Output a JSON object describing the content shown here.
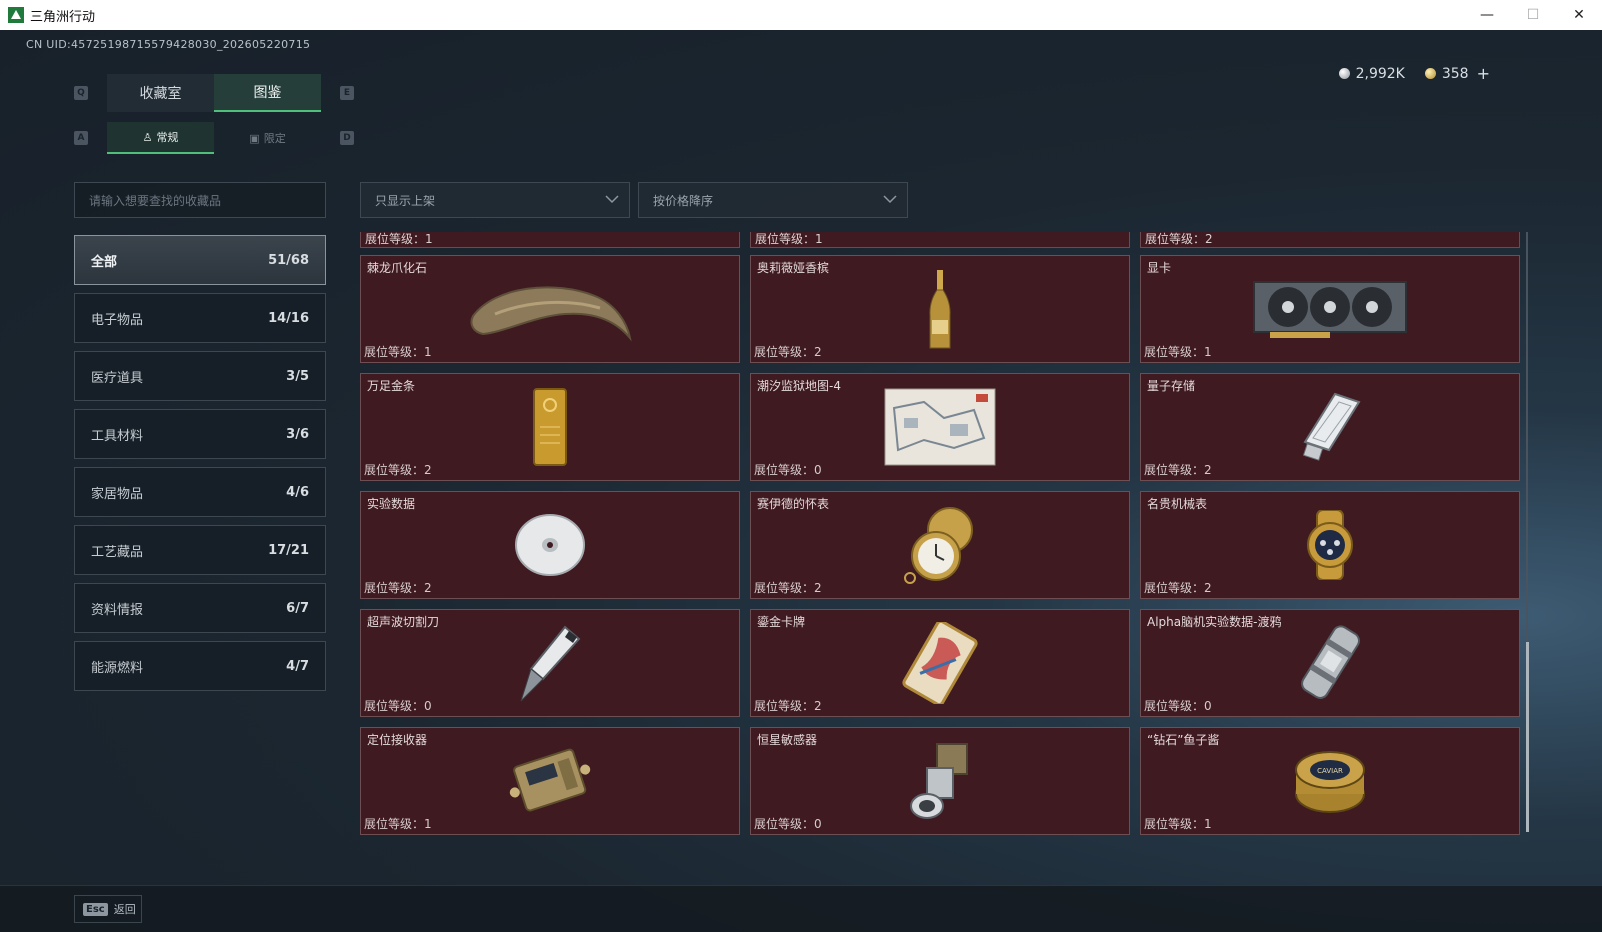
{
  "window": {
    "title": "三角洲行动",
    "minimize_glyph": "—",
    "maximize_glyph": "☐",
    "close_glyph": "✕"
  },
  "uid": "CN UID:45725198715579428030_202605220715",
  "currency": {
    "silver": "2,992K",
    "gold": "358",
    "add_glyph": "+"
  },
  "key_hints": {
    "q": "Q",
    "e": "E",
    "a": "A",
    "d": "D"
  },
  "main_tabs": [
    {
      "label": "收藏室"
    },
    {
      "label": "图鉴"
    }
  ],
  "sub_tabs": [
    {
      "label": "常规"
    },
    {
      "label": "限定"
    }
  ],
  "search": {
    "placeholder": "请输入想要查找的收藏品"
  },
  "filters": {
    "shelf_filter": "只显示上架",
    "sort": "按价格降序"
  },
  "categories": [
    {
      "label": "全部",
      "count": "51/68"
    },
    {
      "label": "电子物品",
      "count": "14/16"
    },
    {
      "label": "医疗道具",
      "count": "3/5"
    },
    {
      "label": "工具材料",
      "count": "3/6"
    },
    {
      "label": "家居物品",
      "count": "4/6"
    },
    {
      "label": "工艺藏品",
      "count": "17/21"
    },
    {
      "label": "资料情报",
      "count": "6/7"
    },
    {
      "label": "能源燃料",
      "count": "4/7"
    }
  ],
  "partial_row": [
    {
      "level": "展位等级：1"
    },
    {
      "level": "展位等级：1"
    },
    {
      "level": "展位等级：2"
    }
  ],
  "items": [
    {
      "name": "棘龙爪化石",
      "level": "展位等级：1",
      "icon": "claw-fossil-icon"
    },
    {
      "name": "奥莉薇娅香槟",
      "level": "展位等级：2",
      "icon": "champagne-bottle-icon"
    },
    {
      "name": "显卡",
      "level": "展位等级：1",
      "icon": "graphics-card-icon"
    },
    {
      "name": "万足金条",
      "level": "展位等级：2",
      "icon": "gold-bar-icon"
    },
    {
      "name": "潮汐监狱地图-4",
      "level": "展位等级：0",
      "icon": "map-icon"
    },
    {
      "name": "量子存储",
      "level": "展位等级：2",
      "icon": "quantum-storage-icon"
    },
    {
      "name": "实验数据",
      "level": "展位等级：2",
      "icon": "disc-icon"
    },
    {
      "name": "赛伊德的怀表",
      "level": "展位等级：2",
      "icon": "pocket-watch-icon"
    },
    {
      "name": "名贵机械表",
      "level": "展位等级：2",
      "icon": "wristwatch-icon"
    },
    {
      "name": "超声波切割刀",
      "level": "展位等级：0",
      "icon": "ultrasonic-knife-icon"
    },
    {
      "name": "鎏金卡牌",
      "level": "展位等级：2",
      "icon": "gilded-card-icon"
    },
    {
      "name": "Alpha脑机实验数据-渡鸦",
      "level": "展位等级：0",
      "icon": "data-canister-icon"
    },
    {
      "name": "定位接收器",
      "level": "展位等级：1",
      "icon": "gps-receiver-icon"
    },
    {
      "name": "恒星敏感器",
      "level": "展位等级：0",
      "icon": "star-sensor-icon"
    },
    {
      "name": "“钻石”鱼子酱",
      "level": "展位等级：1",
      "icon": "caviar-tin-icon"
    }
  ],
  "caviar_label": "CAVIAR",
  "bottom": {
    "esc": "Esc",
    "back_label": "返回"
  }
}
